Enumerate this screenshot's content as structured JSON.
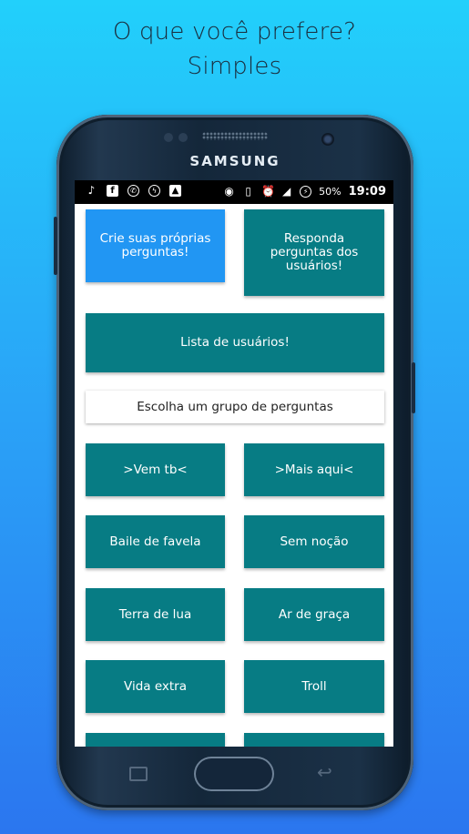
{
  "promo": {
    "line1": "O que você prefere?",
    "line2": "Simples"
  },
  "device": {
    "brand": "SAMSUNG"
  },
  "status_bar": {
    "left_icons": [
      "music-note-icon",
      "facebook-icon",
      "whatsapp-icon",
      "messenger-icon",
      "image-icon"
    ],
    "right_icons": [
      "hotspot-icon",
      "vibrate-icon",
      "alarm-icon",
      "signal-icon",
      "battery-charging-icon"
    ],
    "battery": "50%",
    "time": "19:09"
  },
  "actions": {
    "create_questions": "Crie suas próprias perguntas!",
    "answer_questions": "Responda perguntas dos usuários!",
    "user_list": "Lista de usuários!"
  },
  "section": {
    "choose_group": "Escolha um grupo de perguntas"
  },
  "groups": [
    ">Vem tb<",
    ">Mais aqui<",
    "Baile de favela",
    "Sem noção",
    "Terra de lua",
    "Ar de graça",
    "Vida extra",
    "Troll"
  ],
  "colors": {
    "teal": "#077c84",
    "blue": "#2196f3",
    "background_top": "#22d0fb",
    "background_bottom": "#2b76ef"
  }
}
